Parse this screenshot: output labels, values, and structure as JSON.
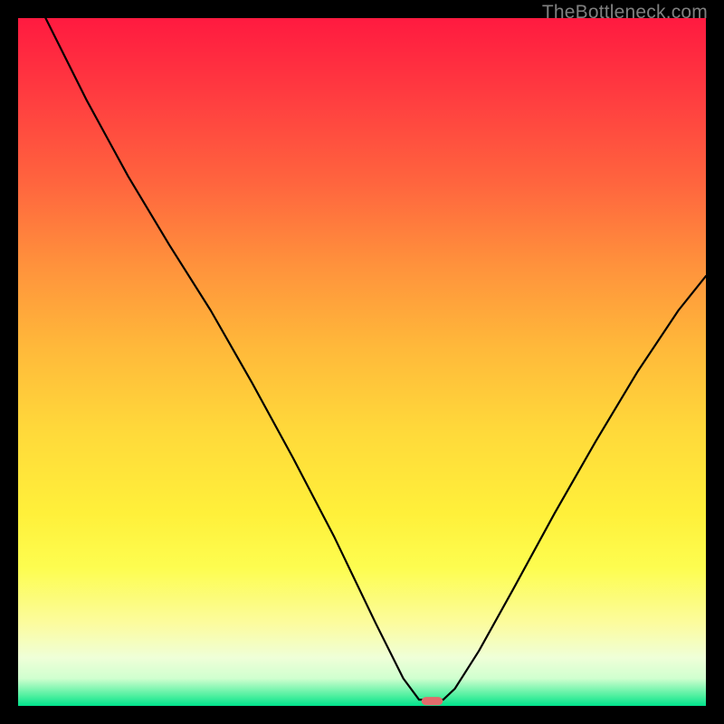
{
  "watermark": "TheBottleneck.com",
  "chart_data": {
    "type": "line",
    "title": "",
    "xlabel": "",
    "ylabel": "",
    "xlim": [
      0,
      100
    ],
    "ylim": [
      0,
      100
    ],
    "grid": false,
    "curve_xy_pct": [
      [
        4,
        100
      ],
      [
        10,
        88
      ],
      [
        16,
        77
      ],
      [
        22,
        67
      ],
      [
        28,
        57.5
      ],
      [
        34,
        47
      ],
      [
        40,
        36
      ],
      [
        46,
        24.5
      ],
      [
        52,
        12
      ],
      [
        56,
        4
      ],
      [
        58.3,
        0.9
      ],
      [
        60,
        0.9
      ],
      [
        61.8,
        0.9
      ],
      [
        63.5,
        2.5
      ],
      [
        67,
        8
      ],
      [
        72,
        17
      ],
      [
        78,
        28
      ],
      [
        84,
        38.5
      ],
      [
        90,
        48.5
      ],
      [
        96,
        57.5
      ],
      [
        100,
        62.5
      ]
    ],
    "marker": {
      "x_pct": 60.2,
      "y_pct": 0.7,
      "w_pct": 3.1,
      "h_pct": 1.2
    }
  }
}
